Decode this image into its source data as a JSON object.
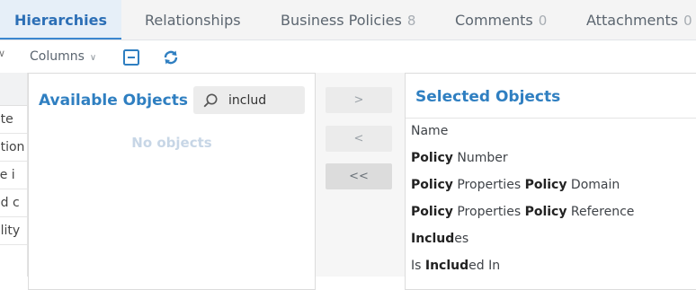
{
  "tabs": [
    {
      "label": "Hierarchies",
      "count": "",
      "active": true
    },
    {
      "label": "Relationships",
      "count": ""
    },
    {
      "label": "Business Policies",
      "count": "8"
    },
    {
      "label": "Comments",
      "count": "0"
    },
    {
      "label": "Attachments",
      "count": "0"
    }
  ],
  "toolbar": {
    "columns_label": "Columns",
    "collapse_icon": "collapse-square-icon",
    "refresh_icon": "refresh-icon"
  },
  "grid_rows": [
    "ate",
    "ation",
    "ce i",
    "ed c",
    "ality"
  ],
  "available": {
    "title": "Available Objects",
    "search_value": "includ",
    "empty_text": "No objects"
  },
  "buttons": {
    "add": ">",
    "remove": "<",
    "remove_all": "<<"
  },
  "selected": {
    "title": "Selected Objects",
    "items": [
      [
        {
          "t": "Name",
          "b": false
        }
      ],
      [
        {
          "t": "Policy",
          "b": true
        },
        {
          "t": " Number",
          "b": false
        }
      ],
      [
        {
          "t": "Policy",
          "b": true
        },
        {
          "t": " Properties ",
          "b": false
        },
        {
          "t": "Policy",
          "b": true
        },
        {
          "t": " Domain",
          "b": false
        }
      ],
      [
        {
          "t": "Policy",
          "b": true
        },
        {
          "t": " Properties ",
          "b": false
        },
        {
          "t": "Policy",
          "b": true
        },
        {
          "t": " Reference",
          "b": false
        }
      ],
      [
        {
          "t": "Includ",
          "b": true
        },
        {
          "t": "es",
          "b": false
        }
      ],
      [
        {
          "t": "Is ",
          "b": false
        },
        {
          "t": "Includ",
          "b": true
        },
        {
          "t": "ed In",
          "b": false
        }
      ]
    ]
  },
  "colors": {
    "accent": "#2f7fc1",
    "tab_active_bg": "#e6eff8"
  }
}
